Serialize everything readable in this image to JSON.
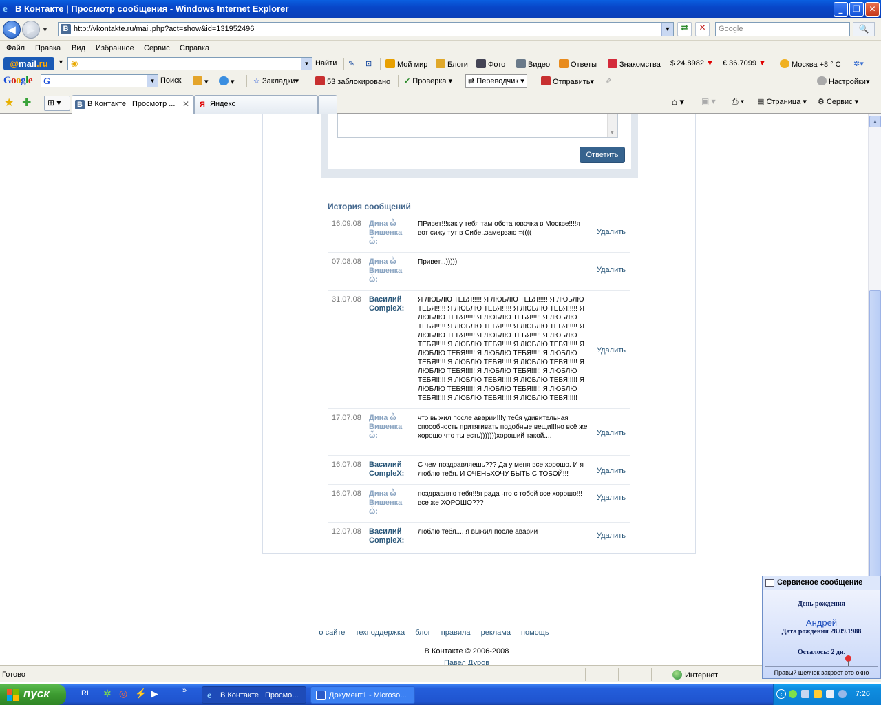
{
  "window": {
    "title": "В Контакте | Просмотр сообщения - Windows Internet Explorer",
    "min": "_",
    "max": "❐",
    "close": "✕"
  },
  "address": {
    "url": "http://vkontakte.ru/mail.php?act=show&id=131952496",
    "search_placeholder": "Google"
  },
  "menu": [
    "Файл",
    "Правка",
    "Вид",
    "Избранное",
    "Сервис",
    "Справка"
  ],
  "mailru_bar": {
    "logo_at": "@",
    "logo_mail": "mail",
    "logo_ru": ".ru",
    "find": "Найти",
    "items": [
      "Мой мир",
      "Блоги",
      "Фото",
      "Видео",
      "Ответы",
      "Знакомства"
    ],
    "usd": "$ 24.8982",
    "eur": "€ 36.7099",
    "weather": "Москва +8 ° C"
  },
  "google_bar": {
    "logo": "Google",
    "search": "Поиск",
    "bookmarks": "Закладки",
    "blocked": "53 заблокировано",
    "spell": "Проверка",
    "translate": "Переводчик",
    "send": "Отправить",
    "settings": "Настройки"
  },
  "tabs": {
    "active": "В Контакте | Просмотр ...",
    "second": "Яндекс",
    "page": "Страница",
    "service": "Сервис"
  },
  "reply": {
    "button": "Ответить"
  },
  "history": {
    "title": "История сообщений",
    "delete_label": "Удалить",
    "messages": [
      {
        "date": "16.09.08",
        "author": "Дина ὦ Вишенка ὦ:",
        "text": "ПРивет!!!как у тебя там обстановочка в Москве!!!!я вот сижу тут в Сибе..замерзаю =(((("
      },
      {
        "date": "07.08.08",
        "author": "Дина ὦ Вишенка ὦ:",
        "text": "Привет...)))))"
      },
      {
        "date": "31.07.08",
        "author": "Василий CompleX:",
        "text": "Я ЛЮБЛЮ ТЕБЯ!!!!! Я ЛЮБЛЮ ТЕБЯ!!!!! Я ЛЮБЛЮ ТЕБЯ!!!!! Я ЛЮБЛЮ ТЕБЯ!!!!! Я ЛЮБЛЮ ТЕБЯ!!!!! Я ЛЮБЛЮ ТЕБЯ!!!!! Я ЛЮБЛЮ ТЕБЯ!!!!! Я ЛЮБЛЮ ТЕБЯ!!!!! Я ЛЮБЛЮ ТЕБЯ!!!!! Я ЛЮБЛЮ ТЕБЯ!!!!! Я ЛЮБЛЮ ТЕБЯ!!!!! Я ЛЮБЛЮ ТЕБЯ!!!!! Я ЛЮБЛЮ ТЕБЯ!!!!! Я ЛЮБЛЮ ТЕБЯ!!!!! Я ЛЮБЛЮ ТЕБЯ!!!!! Я ЛЮБЛЮ ТЕБЯ!!!!! Я ЛЮБЛЮ ТЕБЯ!!!!! Я ЛЮБЛЮ ТЕБЯ!!!!! Я ЛЮБЛЮ ТЕБЯ!!!!! Я ЛЮБЛЮ ТЕБЯ!!!!! Я ЛЮБЛЮ ТЕБЯ!!!!! Я ЛЮБЛЮ ТЕБЯ!!!!! Я ЛЮБЛЮ ТЕБЯ!!!!! Я ЛЮБЛЮ ТЕБЯ!!!!! Я ЛЮБЛЮ ТЕБЯ!!!!! Я ЛЮБЛЮ ТЕБЯ!!!!! Я ЛЮБЛЮ ТЕБЯ!!!!! Я ЛЮБЛЮ ТЕБЯ!!!!! Я ЛЮБЛЮ ТЕБЯ!!!!! Я ЛЮБЛЮ ТЕБЯ!!!!!"
      },
      {
        "date": "17.07.08",
        "author": "Дина ὦ Вишенка ὦ:",
        "text": "что выжил после аварии!!!у тебя удивительная способность притягивать подобные вещи!!!но всё же хорошо,что ты есть)))))))хороший такой...."
      },
      {
        "date": "16.07.08",
        "author": "Василий CompleX:",
        "text": "С чем поздравляешь??? Да у меня все хорошо. И я люблю тебя. И ОЧЕНЬХОЧУ БЫТЬ С ТОБОЙ!!!"
      },
      {
        "date": "16.07.08",
        "author": "Дина ὦ Вишенка ὦ:",
        "text": "поздравляю тебя!!!я рада что с тобой все хорошо!!!все же ХОРОШО???"
      },
      {
        "date": "12.07.08",
        "author": "Василий CompleX:",
        "text": "люблю тебя.... я выжил после аварии"
      }
    ]
  },
  "footer": {
    "links": [
      "о сайте",
      "техподдержка",
      "блог",
      "правила",
      "реклама",
      "помощь"
    ],
    "copyright": "В Контакте © 2006-2008",
    "author": "Павел Дуров"
  },
  "status": {
    "ready": "Готово",
    "zone": "Интернет"
  },
  "popup": {
    "title": "Сервисное сообщение",
    "heading": "День рождения",
    "name": "Андрей",
    "birthdate": "Дата рождения 28.09.1988",
    "remaining": "Осталось: 2 дн.",
    "hint": "Правый щелчок закроет это окно"
  },
  "taskbar": {
    "start": "пуск",
    "lang": "RL",
    "tasks": [
      "В Контакте | Просмо...",
      "Документ1 - Microso..."
    ],
    "clock": "7:26"
  },
  "colors": {
    "vk_link": "#2b587a",
    "vk_author_dina": "#8ba5c2",
    "vk_button": "#36638e",
    "xp_title": "#0a46c8",
    "xp_start": "#3c9a30"
  }
}
